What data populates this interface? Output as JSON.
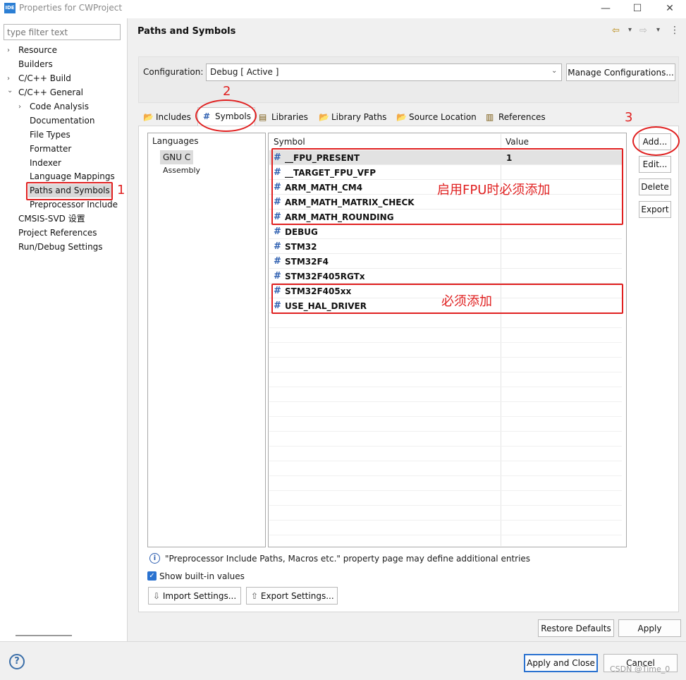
{
  "window": {
    "app_icon": "IDE",
    "title": "Properties for CWProject",
    "minimize": "—",
    "maximize": "☐",
    "close": "✕"
  },
  "nav": {
    "filter_placeholder": "type filter text",
    "items": [
      {
        "label": "Resource",
        "chevron": "›"
      },
      {
        "label": "Builders",
        "chevron": ""
      },
      {
        "label": "C/C++ Build",
        "chevron": "›"
      },
      {
        "label": "C/C++ General",
        "chevron": "⌄"
      },
      {
        "label": "Code Analysis",
        "chevron": "›"
      },
      {
        "label": "Documentation",
        "chevron": ""
      },
      {
        "label": "File Types",
        "chevron": ""
      },
      {
        "label": "Formatter",
        "chevron": ""
      },
      {
        "label": "Indexer",
        "chevron": ""
      },
      {
        "label": "Language Mappings",
        "chevron": ""
      },
      {
        "label": "Paths and Symbols",
        "chevron": ""
      },
      {
        "label": "Preprocessor Include",
        "chevron": ""
      },
      {
        "label": "CMSIS-SVD 设置",
        "chevron": ""
      },
      {
        "label": "Project References",
        "chevron": ""
      },
      {
        "label": "Run/Debug Settings",
        "chevron": ""
      }
    ]
  },
  "header": {
    "title": "Paths and Symbols",
    "back_icon": "⇦",
    "forward_icon": "⇨",
    "menu_icon": "⋮",
    "dropdown_icon": "▾"
  },
  "config": {
    "label": "Configuration:",
    "value": "Debug  [ Active ]",
    "manage_button": "Manage Configurations..."
  },
  "tabs": [
    {
      "label": "Includes",
      "icon": "folder-icon"
    },
    {
      "label": "Symbols",
      "icon": "hash-icon"
    },
    {
      "label": "Libraries",
      "icon": "library-icon"
    },
    {
      "label": "Library Paths",
      "icon": "folder-icon"
    },
    {
      "label": "Source Location",
      "icon": "folder-icon"
    },
    {
      "label": "References",
      "icon": "document-icon"
    }
  ],
  "languages": {
    "header": "Languages",
    "items": [
      "GNU C",
      "Assembly"
    ]
  },
  "table": {
    "columns": [
      "Symbol",
      "Value"
    ],
    "rows": [
      {
        "symbol": "__FPU_PRESENT",
        "value": "1"
      },
      {
        "symbol": "__TARGET_FPU_VFP",
        "value": ""
      },
      {
        "symbol": "ARM_MATH_CM4",
        "value": ""
      },
      {
        "symbol": "ARM_MATH_MATRIX_CHECK",
        "value": ""
      },
      {
        "symbol": "ARM_MATH_ROUNDING",
        "value": ""
      },
      {
        "symbol": "DEBUG",
        "value": ""
      },
      {
        "symbol": "STM32",
        "value": ""
      },
      {
        "symbol": "STM32F4",
        "value": ""
      },
      {
        "symbol": "STM32F405RGTx",
        "value": ""
      },
      {
        "symbol": "STM32F405xx",
        "value": ""
      },
      {
        "symbol": "USE_HAL_DRIVER",
        "value": ""
      }
    ]
  },
  "side_buttons": [
    "Add...",
    "Edit...",
    "Delete",
    "Export"
  ],
  "annotations": {
    "step1": "1",
    "step2": "2",
    "step3": "3",
    "note_fpu": "启用FPU时必须添加",
    "note_required": "必须添加",
    "color": "#e02020"
  },
  "bottom": {
    "info_icon": "i",
    "info_text": "\"Preprocessor Include Paths, Macros etc.\" property page may define additional entries",
    "show_builtin_label": "Show built-in values",
    "show_builtin_checked": true,
    "import_button": "Import Settings...",
    "export_button": "Export Settings...",
    "restore_button": "Restore Defaults",
    "apply_button": "Apply",
    "apply_close_button": "Apply and Close",
    "cancel_button": "Cancel",
    "help_icon": "?",
    "watermark": "CSDN @Time_0"
  },
  "colors": {
    "accent": "#2e5fb0",
    "selection": "#d9d9d9",
    "checkbox": "#2a72d0"
  }
}
